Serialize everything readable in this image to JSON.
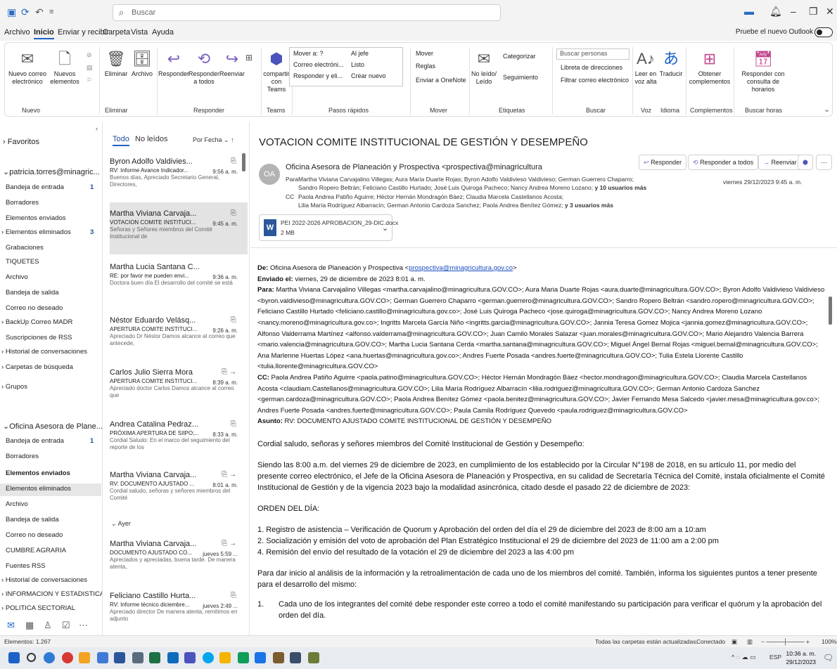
{
  "search": {
    "placeholder": "Buscar"
  },
  "menu": {
    "items": [
      "Archivo",
      "Inicio",
      "Enviar y recibir",
      "Carpeta",
      "Vista",
      "Ayuda"
    ],
    "tryout": "Pruebe el nuevo Outlook"
  },
  "ribbon": {
    "nuevo_correo": "Nuevo correo electrónico",
    "nuevos_elementos": "Nuevos elementos",
    "eliminar": "Eliminar",
    "archivo": "Archivo",
    "responder": "Responder",
    "responder_todos": "Responder a todos",
    "reenviar": "Reenviar",
    "compartir_teams": "compartir con Teams",
    "quick": [
      "Mover a: ?",
      "Correo electróni...",
      "Responder y eli...",
      "Al jefe",
      "Listo",
      "Crear nuevo"
    ],
    "mover": "Mover",
    "reglas": "Reglas",
    "onenote": "Enviar a OneNote",
    "no_leido": "No leído/ Leído",
    "categorizar": "Categorizar",
    "seguimiento": "Seguimiento",
    "buscar_personas": "Buscar personas",
    "libreta": "Libreta de direcciones",
    "filtrar": "Filtrar correo electrónico",
    "leer_voz": "Leer en voz alta",
    "traducir": "Traducir",
    "obtener": "Obtener complementos",
    "responder_horarios": "Responder con consulta de horarios",
    "groups": [
      "Nuevo",
      "Eliminar",
      "Responder",
      "Teams",
      "Pasos rápidos",
      "Mover",
      "Etiquetas",
      "Buscar",
      "Voz",
      "Idioma",
      "Complementos",
      "Buscar horas"
    ]
  },
  "folders": {
    "favoritos": "Favoritos",
    "account1": "patricia.torres@minagric...",
    "items1": [
      "Bandeja de entrada",
      "Borradores",
      "Elementos enviados",
      "Elementos eliminados",
      "Grabaciones",
      "TIQUETES",
      "Archivo",
      "Bandeja de salida",
      "Correo no deseado",
      "BackUp Correo MADR",
      "Suscripciones de RSS",
      "Historial de conversaciones",
      "Carpetas de búsqueda"
    ],
    "count_inbox1": "1",
    "count_deleted1": "3",
    "grupos": "Grupos",
    "account2": "Oficina Asesora de Plane...",
    "items2": [
      "Bandeja de entrada",
      "Borradores",
      "Elementos enviados",
      "Elementos eliminados",
      "Archivo",
      "Bandeja de salida",
      "Correo no deseado",
      "CUMBRE AGRARIA",
      "Fuentes RSS",
      "Historial de conversaciones",
      "INFORMACION Y ESTADISTICA",
      "POLITICA SECTORIAL"
    ],
    "count_inbox2": "1"
  },
  "list": {
    "tab_all": "Todo",
    "tab_unread": "No leídos",
    "sort": "Por Fecha",
    "yesterday": "Ayer",
    "messages": [
      {
        "from": "Byron Adolfo Valdivies...",
        "subject": "RV: Informe Avance Indicador...",
        "time": "9:56 a. m.",
        "preview": "Buenos días, Apreciado Secretario General, Directores,"
      },
      {
        "from": "Martha Viviana Carvaja...",
        "subject": "VOTACION COMITE INSTITUCI...",
        "time": "9:45 a. m.",
        "preview": "Señoras y Señores miembros del Comité Institucional de"
      },
      {
        "from": "Martha Lucia Santana C...",
        "subject": "RE: por favor me pueden envi...",
        "time": "9:36 a. m.",
        "preview": "Doctora buen día El desarrollo del comité se está"
      },
      {
        "from": "Néstor Eduardo Velásq...",
        "subject": "APERTURA COMITE INSTITUCI...",
        "time": "9:26 a. m.",
        "preview": "Apreciado Dr Néstor Damos alcance al correo que antecede,"
      },
      {
        "from": "Carlos Julio Sierra Mora",
        "subject": "APERTURA COMITE INSTITUCI...",
        "time": "8:39 a. m.",
        "preview": "Apreciado doctor Carlos Damos alcance al correo que"
      },
      {
        "from": "Andrea Catalina Pedraz...",
        "subject": "PRÓXIMA APERTURA DE SIIPO;...",
        "time": "8:33 a. m.",
        "preview": "Cordial Saludo: En el marco del seguimiento del reporte de los"
      },
      {
        "from": "Martha Viviana Carvaja...",
        "subject": "RV: DOCUMENTO AJUSTADO ...",
        "time": "8:01 a. m.",
        "preview": "Cordial saludo, señoras y señores miembros del Comité"
      },
      {
        "from": "Martha Viviana Carvaja...",
        "subject": "DOCUMENTO AJUSTADO CO...",
        "time": "jueves 5:59 ...",
        "preview": "Apreciados y apreciadas, buena tarde. De manera atenta,"
      },
      {
        "from": "Feliciano Castillo Hurta...",
        "subject": "RV: Informe técnico diciembre...",
        "time": "jueves 2:49 ...",
        "preview": "Apreciado director De manera atenta, remitimos en adjunto"
      }
    ]
  },
  "reading": {
    "subject": "VOTACION COMITE INSTITUCIONAL DE GESTIÓN Y DESEMPEÑO",
    "avatar": "OA",
    "sender": "Oficina Asesora de Planeación y Prospectiva <prospectiva@minagricultura",
    "to_label": "Para",
    "to_line1": "Martha Viviana Carvajalino Villegas; Aura Maria Duarte Rojas; Byron Adolfo Valdivieso Valdivieso; German Guerrero Chaparro;",
    "to_line2": "Sandro Ropero Beltrán; Feliciano Castillo Hurtado; José Luis Quiroga Pacheco; Nancy Andrea Moreno Lozano;",
    "to_more": "y 10 usuarios más",
    "cc_label": "CC",
    "cc_line1": "Paola Andrea Patiño Aguirre; Héctor Hernán Mondragón Báez; Claudia Marcela Castellanos Acosta;",
    "cc_line2": "Lilia María Rodríguez Albarracín; German Antonio Cardoza Sanchez; Paola Andrea Benítez Gómez;",
    "cc_more": "y 3 usuarios más",
    "date": "viernes 29/12/2023 9:45 a. m.",
    "btn_reply": "Responder",
    "btn_reply_all": "Responder a todos",
    "btn_forward": "Reenviar",
    "attach_name": "PEI 2022-2026 APROBACION_29-DIC.docx",
    "attach_size": "2 MB"
  },
  "body": {
    "de_label": "De:",
    "de_text": "Oficina Asesora de Planeación y Prospectiva",
    "de_email": "prospectiva@minagricultura.gov.co",
    "enviado_label": "Enviado el:",
    "enviado_text": "viernes, 29 de diciembre de 2023 8:01 a. m.",
    "para_label": "Para:",
    "para_text": "Martha Viviana Carvajalino Villegas <martha.carvajalino@minagricultura.GOV.CO>; Aura Maria Duarte Rojas <aura.duarte@minagricultura.GOV.CO>; Byron Adolfo Valdivieso Valdivieso <byron.valdivieso@minagricultura.GOV.CO>; German Guerrero Chaparro <german.guerrero@minagricultura.GOV.CO>; Sandro Ropero Beltrán <sandro.ropero@minagricultura.GOV.CO>; Feliciano Castillo Hurtado <feliciano.castillo@minagricultura.gov.co>; José Luis Quiroga Pacheco <jose.quiroga@minagricultura.GOV.CO>; Nancy Andrea Moreno Lozano <nancy.moreno@minagricultura.gov.co>; Ingritts Marcela García Niño <ingritts.garcia@minagricultura.GOV.CO>; Jannia Teresa Gomez Mojica <jannia.gomez@minagricultura.GOV.CO>; Alfonso Valderrama Martínez <alfonso.valderrama@minagricultura.GOV.CO>; Juan Camilo Morales Salazar <juan.morales@minagricultura.GOV.CO>; Mario Alejandro Valencia Barrera <mario.valencia@minagricultura.GOV.CO>; Martha Lucia Santana Cerda <martha.santana@minagricultura.GOV.CO>; Miguel Ángel Bernal Rojas <miguel.bernal@minagricultura.GOV.CO>; Ana Marlenne Huertas López <ana.huertas@minagricultura.gov.co>; Andres Fuerte Posada <andres.fuerte@minagricultura.GOV.CO>; Tulia Estela Llorente Castillo <tulia.llorente@minagricultura.GOV.CO>",
    "cc_label": "CC:",
    "cc_text": "Paola Andrea Patiño Aguirre <paola.patino@minagricultura.GOV.CO>; Héctor Hernán Mondragón Báez <hector.mondragon@minagricultura.GOV.CO>; Claudia Marcela Castellanos Acosta <claudiam.Castellanos@minagricultura.GOV.CO>; Lilia María Rodríguez Albarracín <lilia.rodriguez@minagricultura.GOV.CO>; German Antonio Cardoza Sanchez <german.cardoza@minagricultura.GOV.CO>; Paola Andrea Benítez Gómez <paola.benitez@minagricultura.GOV.CO>; Javier Fernando Mesa Salcedo <javier.mesa@minagricultura.gov.co>; Andres Fuerte Posada <andres.fuerte@minagricultura.GOV.CO>; Paula Camila Rodríguez Quevedo <paula.rodriguez@minagricultura.GOV.CO>",
    "asunto_label": "Asunto:",
    "asunto_text": "RV: DOCUMENTO AJUSTADO COMITE INSTITUCIONAL DE GESTIÓN Y DESEMPEÑO",
    "greeting": "Cordial saludo, señoras y señores miembros del Comité Institucional de Gestión y Desempeño:",
    "para1": "Siendo las 8:00 a.m. del viernes 29 de diciembre de 2023, en cumplimiento de los establecido por la Circular N°198 de 2018, en su artículo 11, por medio del presente correo electrónico, el Jefe de la Oficina Asesora de Planeación y Prospectiva, en su calidad de Secretaría Técnica del Comité, instala oficialmente el Comité Institucional de Gestión y de la vigencia 2023 bajo la modalidad asincrónica, citado desde el pasado 22 de diciembre de 2023:",
    "orden": "ORDEN DEL DÍA:",
    "item1": "1. Registro de asistencia – Verificación de Quorum y Aprobación del orden del día el 29 de diciembre del 2023 de 8:00 am a 10:am",
    "item2": "2. Socialización y emisión del voto de aprobación del Plan Estratégico Institucional el 29 de diciembre del 2023 de 11:00 am a 2:00 pm",
    "item3": "4. Remisión del envío del resultado de la  votación el  29 de diciembre del 2023 a las 4:00 pm",
    "para2": "Para dar inicio al análisis de la información y la retroalimentación de cada uno de los miembros del comité. También, informa los siguientes puntos a tener presente para el desarrollo del mismo:",
    "point1_num": "1.",
    "point1": "Cada uno de los integrantes del comité debe responder este correo a todo el comité manifestando su participación para verificar el quórum y la aprobación del orden del día."
  },
  "status": {
    "elements": "Elementos: 1.267",
    "sync": "Todas las carpetas están actualizadas.",
    "connected": "Conectado",
    "zoom": "100%"
  },
  "clock": {
    "time": "10:36 a. m.",
    "date": "29/12/2023",
    "lang": "ESP"
  }
}
